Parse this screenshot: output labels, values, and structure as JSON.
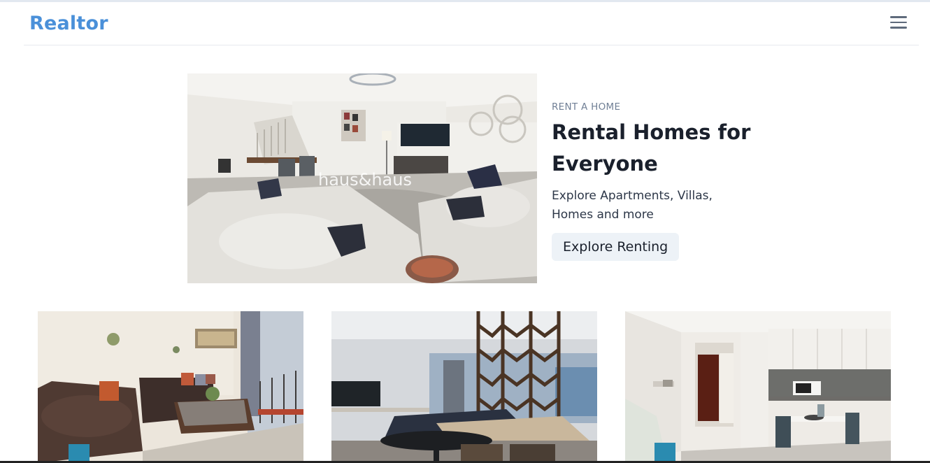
{
  "brand": {
    "logo": "Realtor"
  },
  "hero": {
    "eyebrow": "RENT A HOME",
    "title_line1": "Rental Homes for",
    "title_line2": "Everyone",
    "description": "Explore Apartments, Villas, Homes and more",
    "cta_label": "Explore Renting",
    "watermark": "haus&haus"
  },
  "colors": {
    "brand": "#4a90d9",
    "text": "#1a202c",
    "muted": "#718096",
    "button_bg": "#edf2f7"
  },
  "icons": {
    "menu": "hamburger-menu-icon"
  }
}
